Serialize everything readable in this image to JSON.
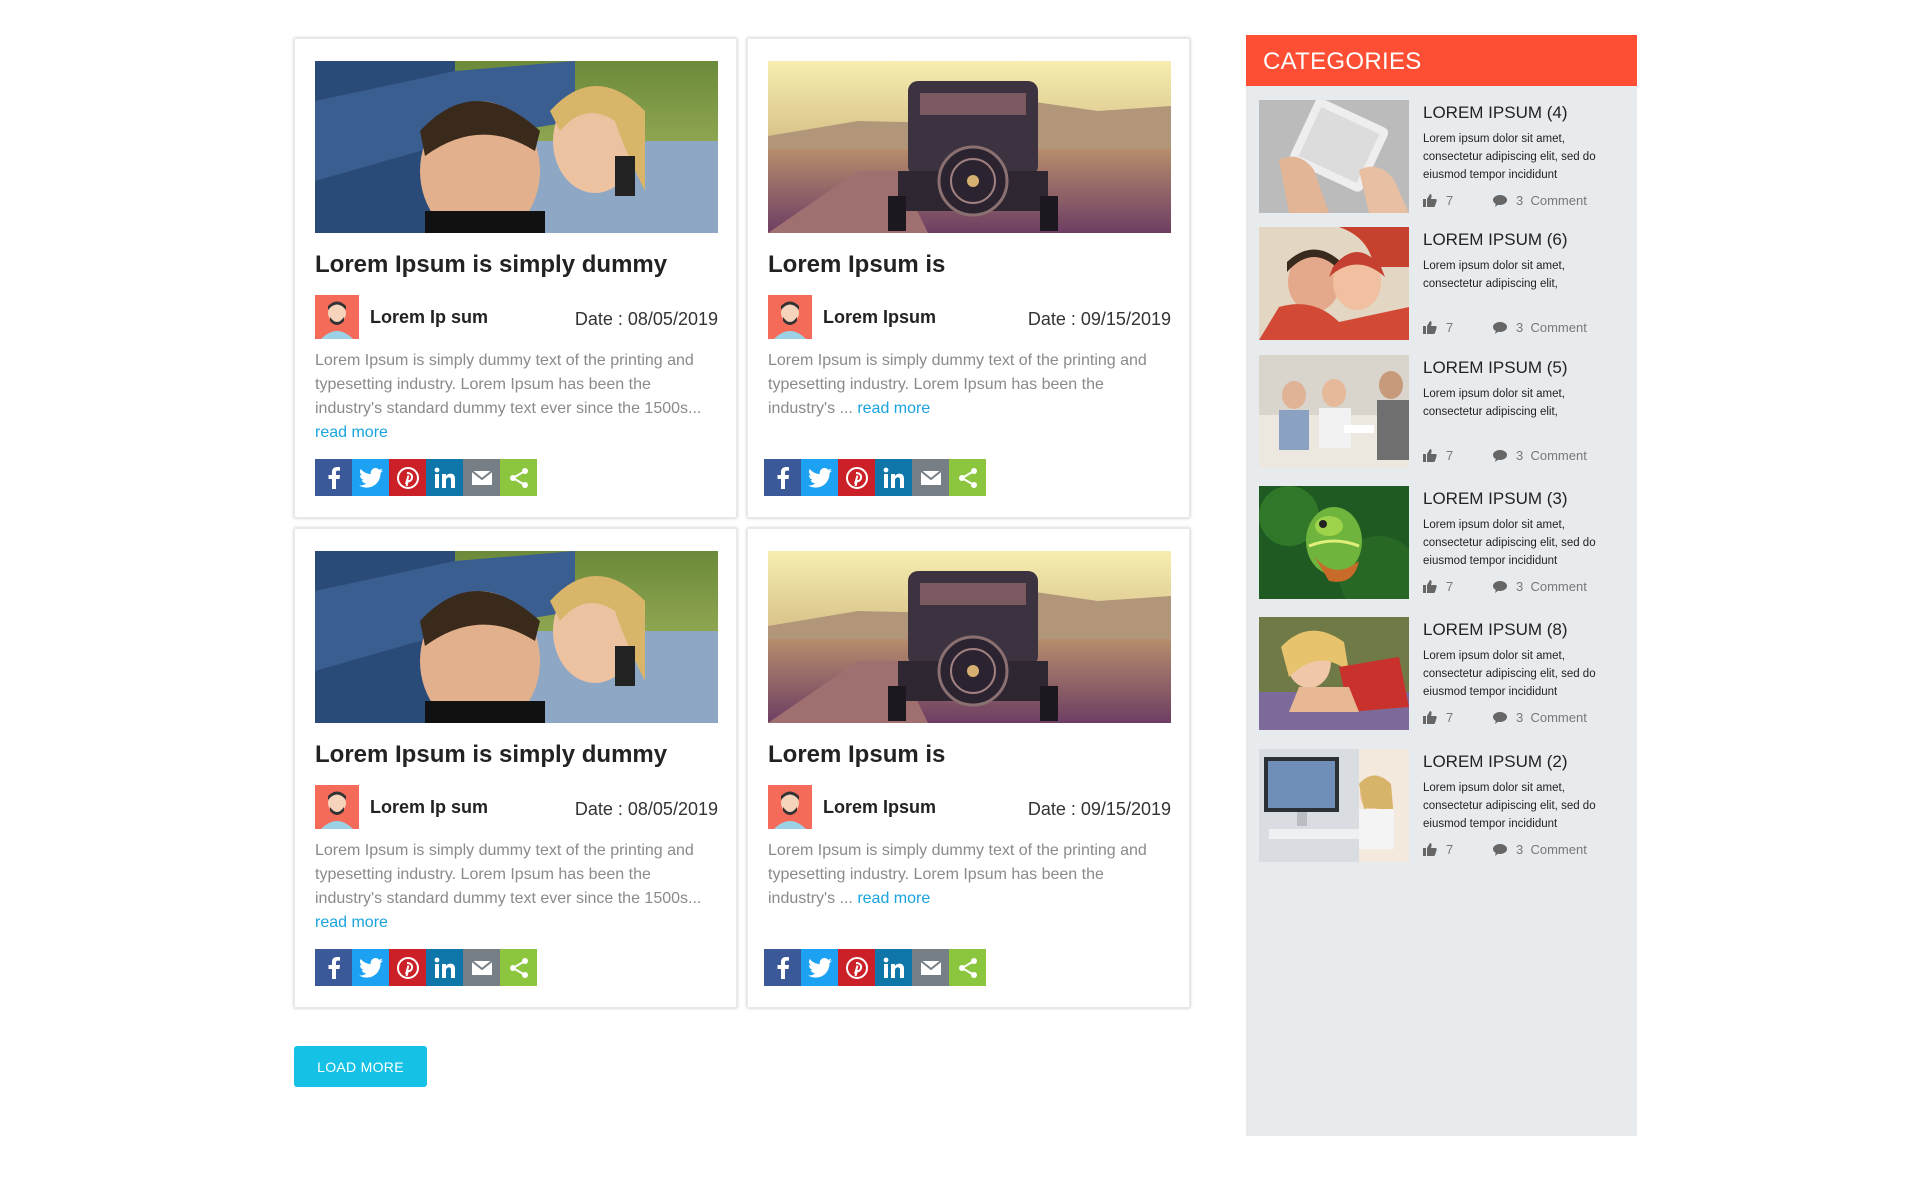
{
  "posts": [
    {
      "title": "Lorem Ipsum is simply dummy",
      "author": "Lorem Ip sum",
      "date": "Date : 08/05/2019",
      "excerpt": "Lorem Ipsum is simply dummy text of the printing and typesetting industry. Lorem Ipsum has been the industry's standard dummy text ever since the 1500s...",
      "read_more": "read more",
      "image": "couple-in-car"
    },
    {
      "title": "Lorem Ipsum is",
      "author": "Lorem Ipsum",
      "date": "Date : 09/15/2019",
      "excerpt": "Lorem Ipsum is simply dummy text of the printing and typesetting industry. Lorem Ipsum has been the industry's ...",
      "read_more": "read more",
      "image": "vintage-car-road"
    },
    {
      "title": "Lorem Ipsum is simply dummy",
      "author": "Lorem Ip sum",
      "date": "Date : 08/05/2019",
      "excerpt": "Lorem Ipsum is simply dummy text of the printing and typesetting industry. Lorem Ipsum has been the industry's standard dummy text ever since the 1500s...",
      "read_more": "read more",
      "image": "couple-in-car"
    },
    {
      "title": "Lorem Ipsum is",
      "author": "Lorem Ipsum",
      "date": "Date : 09/15/2019",
      "excerpt": "Lorem Ipsum is simply dummy text of the printing and typesetting industry. Lorem Ipsum has been the industry's ...",
      "read_more": "read more",
      "image": "vintage-car-road"
    }
  ],
  "share_icons": [
    "facebook-icon",
    "twitter-icon",
    "pinterest-icon",
    "linkedin-icon",
    "email-icon",
    "share-icon"
  ],
  "load_more": "LOAD MORE",
  "sidebar": {
    "heading": "CATEGORIES",
    "items": [
      {
        "title": "LOREM IPSUM (4)",
        "desc": "Lorem ipsum dolor sit amet, consectetur adipiscing elit, sed do eiusmod tempor incididunt",
        "likes": "7",
        "comments": "3  Comment",
        "image": "tablet-hands"
      },
      {
        "title": "LOREM IPSUM (6)",
        "desc": "Lorem ipsum dolor sit amet, consectetur adipiscing elit,",
        "likes": "7",
        "comments": "3  Comment",
        "image": "couple-winter"
      },
      {
        "title": "LOREM IPSUM (5)",
        "desc": "Lorem ipsum dolor sit amet, consectetur adipiscing elit,",
        "likes": "7",
        "comments": "3  Comment",
        "image": "meeting-couch"
      },
      {
        "title": "LOREM IPSUM (3)",
        "desc": "Lorem ipsum dolor sit amet, consectetur adipiscing elit, sed do eiusmod tempor incididunt",
        "likes": "7",
        "comments": "3  Comment",
        "image": "chameleon"
      },
      {
        "title": "LOREM IPSUM (8)",
        "desc": "Lorem ipsum dolor sit amet, consectetur adipiscing elit, sed do eiusmod tempor incididunt",
        "likes": "7",
        "comments": "3  Comment",
        "image": "woman-lavender"
      },
      {
        "title": "LOREM IPSUM (2)",
        "desc": "Lorem ipsum dolor sit amet, consectetur adipiscing elit, sed do eiusmod tempor incididunt",
        "likes": "7",
        "comments": "3  Comment",
        "image": "woman-computer"
      }
    ]
  },
  "colors": {
    "accent": "#fe4e33",
    "link": "#1aa3dd",
    "button": "#16c1e6",
    "sidebar_bg": "#e8ebee"
  }
}
